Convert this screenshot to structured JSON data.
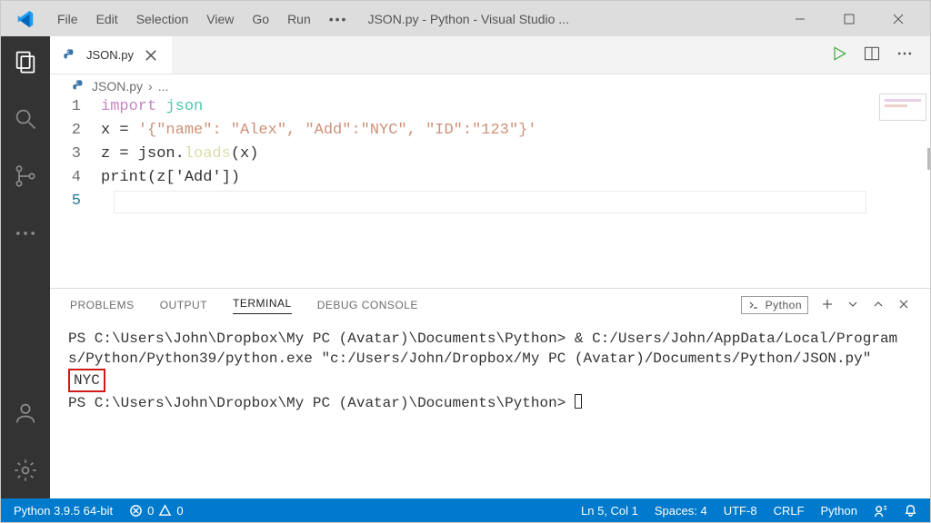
{
  "menu": {
    "file": "File",
    "edit": "Edit",
    "selection": "Selection",
    "view": "View",
    "go": "Go",
    "run": "Run"
  },
  "window_title": "JSON.py - Python - Visual Studio ...",
  "tab": {
    "filename": "JSON.py"
  },
  "breadcrumb": {
    "file": "JSON.py",
    "rest": "..."
  },
  "code": {
    "l1_import": "import",
    "l1_mod": "json",
    "l2_lhs": "x = ",
    "l2_str": "'{\"name\": \"Alex\", \"Add\":\"NYC\", \"ID\":\"123\"}'",
    "l3_lhs": "z = json.",
    "l3_fn": "loads",
    "l3_call": "(x)",
    "l4_text": "print(z['Add'])",
    "gutter": [
      "1",
      "2",
      "3",
      "4",
      "5"
    ]
  },
  "panel": {
    "tabs": {
      "problems": "PROBLEMS",
      "output": "OUTPUT",
      "terminal": "TERMINAL",
      "debug": "DEBUG CONSOLE"
    },
    "shell_label": "Python"
  },
  "terminal": {
    "line1": "PS C:\\Users\\John\\Dropbox\\My PC (Avatar)\\Documents\\Python> & C:/Users/John/AppData/Local/Programs/Python/Python39/python.exe \"c:/Users/John/Dropbox/My PC (Avatar)/Documents/Python/JSON.py\"",
    "output": "NYC",
    "line3_prompt": "PS C:\\Users\\John\\Dropbox\\My PC (Avatar)\\Documents\\Python> "
  },
  "status": {
    "python_ver": "Python 3.9.5 64-bit",
    "errors": "0",
    "warnings": "0",
    "cursor": "Ln 5, Col 1",
    "spaces": "Spaces: 4",
    "encoding": "UTF-8",
    "eol": "CRLF",
    "lang": "Python"
  }
}
